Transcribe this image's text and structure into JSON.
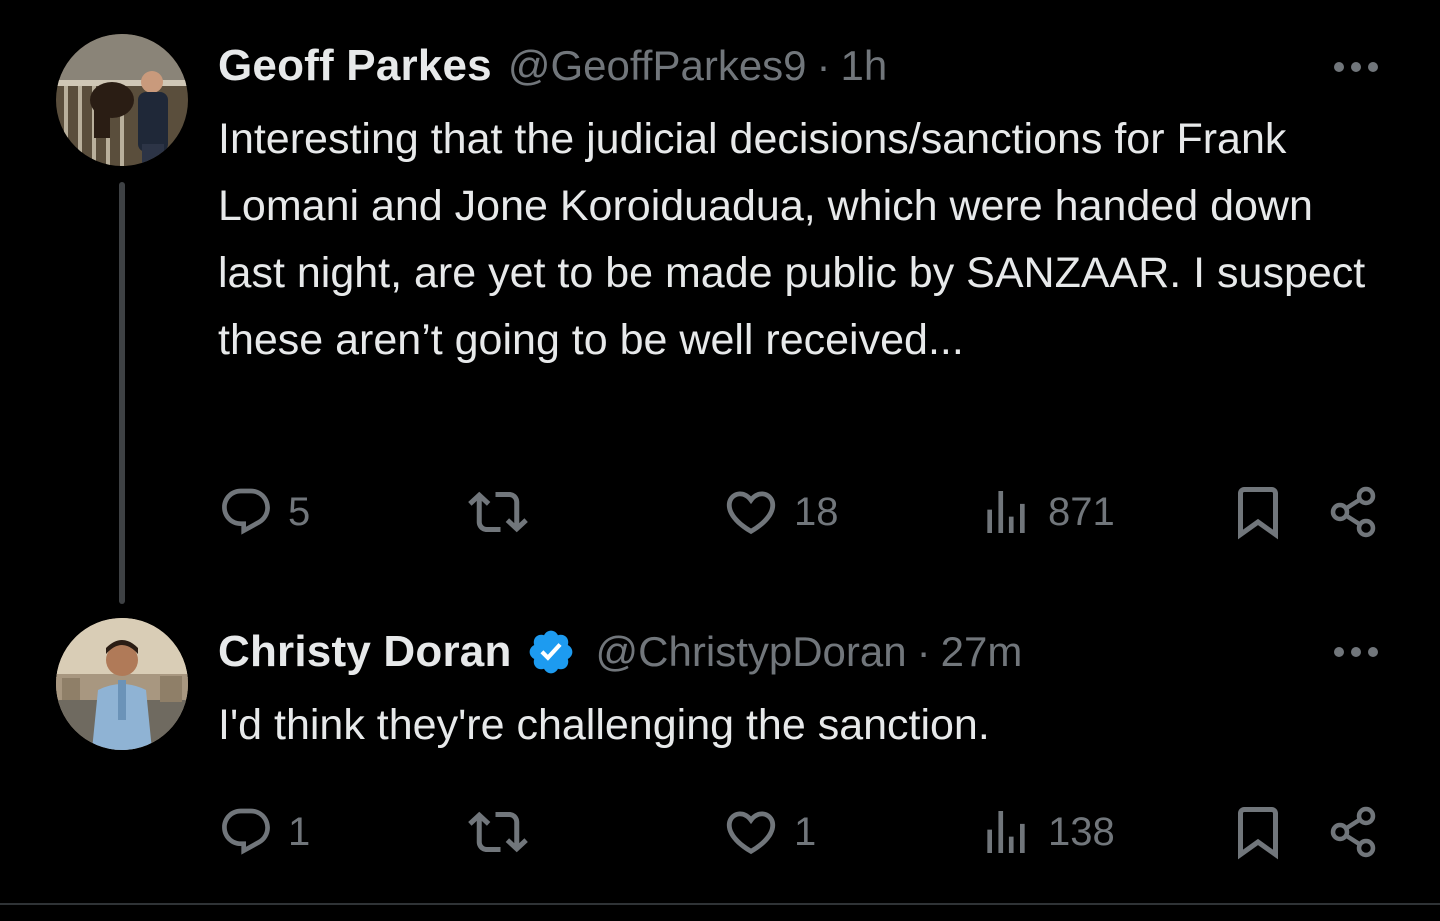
{
  "theme": {
    "background": "#000000",
    "text_primary": "#e7e9ea",
    "text_secondary": "#71767b",
    "verified_blue": "#1d9bf0",
    "thread_line": "#3e4144"
  },
  "tweets": [
    {
      "display_name": "Geoff Parkes",
      "handle": "@GeoffParkes9",
      "separator": "·",
      "time": "1h",
      "verified": false,
      "text": "Interesting that the judicial decisions/sanctions for Frank Lomani and Jone Koroiduadua, which were handed down last night, are yet to be made public by SANZAAR. I suspect these aren’t going to be well received...",
      "actions": {
        "replies": "5",
        "reposts": "",
        "likes": "18",
        "views": "871"
      },
      "icons": [
        "more-icon",
        "reply-icon",
        "repost-icon",
        "like-icon",
        "views-icon",
        "bookmark-icon",
        "share-icon"
      ]
    },
    {
      "display_name": "Christy Doran",
      "handle": "@ChristypDoran",
      "separator": "·",
      "time": "27m",
      "verified": true,
      "text": "I'd think they're challenging the sanction.",
      "actions": {
        "replies": "1",
        "reposts": "",
        "likes": "1",
        "views": "138"
      },
      "icons": [
        "verified-badge-icon",
        "more-icon",
        "reply-icon",
        "repost-icon",
        "like-icon",
        "views-icon",
        "bookmark-icon",
        "share-icon"
      ]
    }
  ]
}
